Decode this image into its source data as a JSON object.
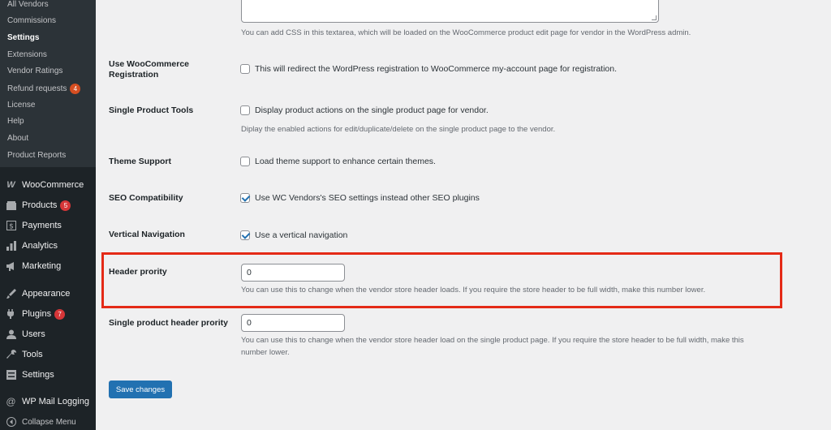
{
  "sidebar": {
    "submenu": [
      {
        "label": "All Vendors"
      },
      {
        "label": "Commissions"
      },
      {
        "label": "Settings",
        "current": true
      },
      {
        "label": "Extensions"
      },
      {
        "label": "Vendor Ratings"
      },
      {
        "label": "Refund requests",
        "badge": "4"
      },
      {
        "label": "License"
      },
      {
        "label": "Help"
      },
      {
        "label": "About"
      },
      {
        "label": "Product Reports"
      }
    ],
    "menu": [
      {
        "label": "WooCommerce",
        "icon": "woocommerce-icon"
      },
      {
        "label": "Products",
        "icon": "products-icon",
        "badge": "5"
      },
      {
        "label": "Payments",
        "icon": "payments-icon"
      },
      {
        "label": "Analytics",
        "icon": "analytics-icon"
      },
      {
        "label": "Marketing",
        "icon": "marketing-icon"
      },
      {
        "label": "Appearance",
        "icon": "appearance-icon"
      },
      {
        "label": "Plugins",
        "icon": "plugins-icon",
        "badge": "7"
      },
      {
        "label": "Users",
        "icon": "users-icon"
      },
      {
        "label": "Tools",
        "icon": "tools-icon"
      },
      {
        "label": "Settings",
        "icon": "settings-icon"
      },
      {
        "label": "WP Mail Logging",
        "icon": "at-icon"
      },
      {
        "label": "Collapse Menu",
        "icon": "collapse-icon"
      }
    ]
  },
  "settings": {
    "css_desc": "You can add CSS in this textarea, which will be loaded on the WooCommerce product edit page for vendor in the WordPress admin.",
    "woo_reg": {
      "label_line1": "Use WooCommerce",
      "label_line2": "Registration",
      "text": "This will redirect the WordPress registration to WooCommerce my-account page for registration.",
      "checked": false
    },
    "single_tools": {
      "label": "Single Product Tools",
      "text": "Display product actions on the single product page for vendor.",
      "desc": "Diplay the enabled actions for edit/duplicate/delete on the single product page to the vendor.",
      "checked": false
    },
    "theme_support": {
      "label": "Theme Support",
      "text": "Load theme support to enhance certain themes.",
      "checked": false
    },
    "seo": {
      "label": "SEO Compatibility",
      "text": "Use WC Vendors's SEO settings instead other SEO plugins",
      "checked": true
    },
    "vertical_nav": {
      "label": "Vertical Navigation",
      "text": "Use a vertical navigation",
      "checked": true
    },
    "header_priority": {
      "label": "Header prority",
      "value": "0",
      "desc": "You can use this to change when the vendor store header loads. If you require the store header to be full width, make this number lower."
    },
    "single_header_priority": {
      "label": "Single product header prority",
      "value": "0",
      "desc_line1": "You can use this to change when the vendor store header load on the single product page. If you require the store header to be full width, make this",
      "desc_line2": "number lower."
    },
    "save_label": "Save changes"
  },
  "colors": {
    "sidebar_bg": "#1d2327",
    "submenu_bg": "#2c3338",
    "content_bg": "#f0f0f1",
    "accent": "#2271b1",
    "badge": "#d63638",
    "highlight": "#e42a17"
  }
}
